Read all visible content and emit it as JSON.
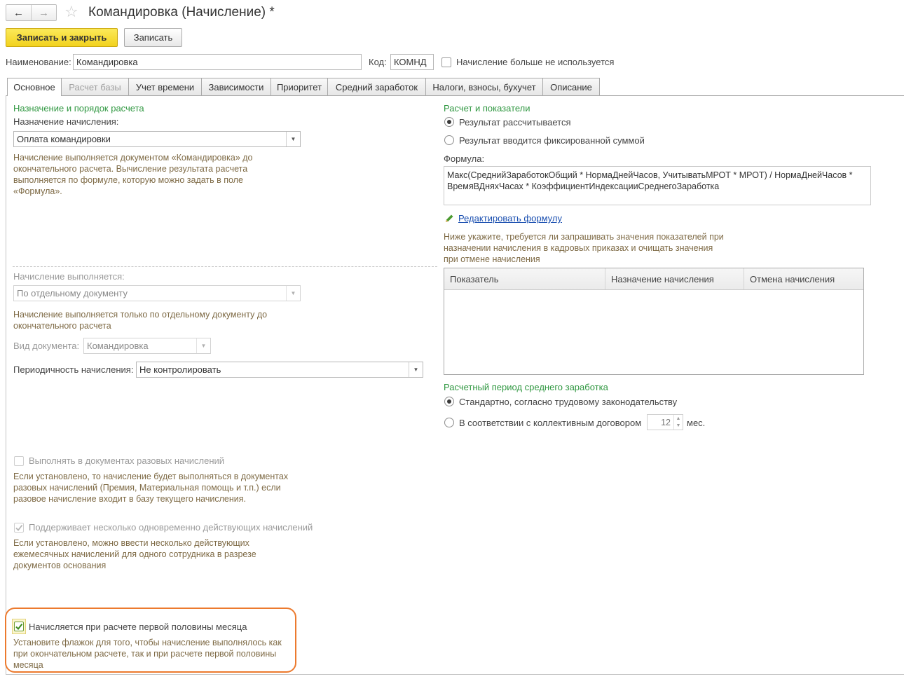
{
  "window": {
    "title": "Командировка (Начисление) *"
  },
  "toolbar": {
    "save_close_label": "Записать и закрыть",
    "save_label": "Записать"
  },
  "header": {
    "name_label": "Наименование:",
    "name_value": "Командировка",
    "code_label": "Код:",
    "code_value": "КОМНД",
    "not_used_label": "Начисление больше не используется"
  },
  "tabs": [
    {
      "label": "Основное"
    },
    {
      "label": "Расчет базы"
    },
    {
      "label": "Учет времени"
    },
    {
      "label": "Зависимости"
    },
    {
      "label": "Приоритет"
    },
    {
      "label": "Средний заработок"
    },
    {
      "label": "Налоги, взносы, бухучет"
    },
    {
      "label": "Описание"
    }
  ],
  "left": {
    "section_title": "Назначение и порядок расчета",
    "purpose_label": "Назначение начисления:",
    "purpose_value": "Оплата командировки",
    "purpose_hint": "Начисление выполняется документом «Командировка» до окончательного расчета. Вычисление результата расчета выполняется по формуле, которую можно задать в поле «Формула».",
    "performed_label": "Начисление выполняется:",
    "performed_value": "По отдельному документу",
    "performed_hint": "Начисление выполняется только по отдельному документу до окончательного расчета",
    "doc_type_label": "Вид документа:",
    "doc_type_value": "Командировка",
    "periodicity_label": "Периодичность начисления:",
    "periodicity_value": "Не контролировать",
    "one_time_label": "Выполнять в документах разовых начислений",
    "one_time_hint": "Если установлено, то начисление будет выполняться в документах разовых начислений (Премия, Материальная помощь и т.п.) если разовое начисление входит в базу текущего начисления.",
    "multi_label": "Поддерживает несколько одновременно действующих начислений",
    "multi_hint": "Если установлено, можно ввести несколько действующих ежемесячных начислений для одного сотрудника в разрезе документов основания",
    "first_half_label": "Начисляется при расчете первой половины месяца",
    "first_half_hint": "Установите флажок для того, чтобы начисление выполнялось как при окончательном расчете, так и при расчете первой половины месяца"
  },
  "right": {
    "section_title": "Расчет и показатели",
    "radio_calculated": "Результат рассчитывается",
    "radio_fixed": "Результат вводится фиксированной суммой",
    "formula_label": "Формула:",
    "formula_value": "Макс(СреднийЗаработокОбщий * НормаДнейЧасов, УчитыватьМРОТ * МРОТ) / НормаДнейЧасов * ВремяВДняхЧасах * КоэффициентИндексацииСреднегоЗаработка",
    "edit_formula_link": "Редактировать формулу",
    "indicators_hint": "Ниже укажите, требуется ли запрашивать значения показателей при назначении начисления в кадровых приказах и очищать значения при отмене начисления",
    "table_columns": [
      "Показатель",
      "Назначение начисления",
      "Отмена начисления"
    ],
    "avg_section_title": "Расчетный период среднего заработка",
    "radio_standard": "Стандартно, согласно трудовому законодательству",
    "radio_collective": "В соответствии с коллективным договором",
    "months_value": "12",
    "months_unit": "мес."
  },
  "icons": [
    "arrow-left-icon",
    "arrow-right-icon",
    "star-icon",
    "pencil-icon",
    "chevron-down-icon",
    "checkmark-icon"
  ],
  "colors": {
    "primary_button": "#f2d21e",
    "section_title": "#2f9740",
    "hint_text": "#7e6a45",
    "highlight": "#ec7a2e",
    "link": "#1a4fb0"
  }
}
